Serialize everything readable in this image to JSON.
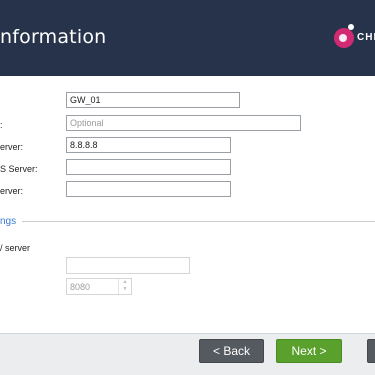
{
  "header": {
    "title": "nformation",
    "logo_text": "CHE"
  },
  "form": {
    "name": {
      "label": "",
      "value": "GW_01"
    },
    "description": {
      "label": ":",
      "placeholder": "Optional"
    },
    "dns_server": {
      "label": "erver:",
      "value": "8.8.8.8"
    },
    "dns_server_2": {
      "label": "S Server:",
      "value": ""
    },
    "ntp_server": {
      "label": "erver:",
      "value": ""
    }
  },
  "proxy_section": {
    "title": "ngs",
    "proxy_label": "/ server",
    "address_value": "",
    "port_value": "8080"
  },
  "footer": {
    "back_label": "< Back",
    "next_label": "Next >"
  },
  "colors": {
    "header_bg": "#26334a",
    "accent_blue": "#3a7bd5",
    "next_green": "#5aa02c",
    "logo_pink": "#d12a72"
  }
}
